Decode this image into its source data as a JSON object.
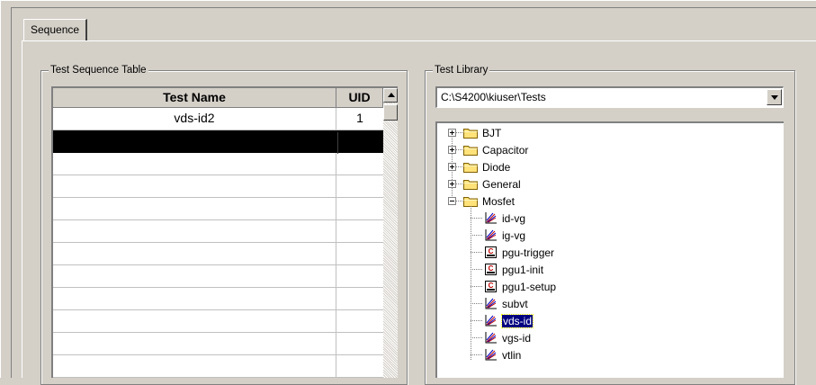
{
  "tab": {
    "label": "Sequence"
  },
  "sequence_group": {
    "title": "Test Sequence Table",
    "columns": [
      "Test Name",
      "UID"
    ],
    "rows": [
      {
        "name": "vds-id2",
        "uid": "1"
      },
      {
        "name": "",
        "uid": ""
      },
      {
        "name": "",
        "uid": ""
      },
      {
        "name": "",
        "uid": ""
      },
      {
        "name": "",
        "uid": ""
      },
      {
        "name": "",
        "uid": ""
      },
      {
        "name": "",
        "uid": ""
      },
      {
        "name": "",
        "uid": ""
      },
      {
        "name": "",
        "uid": ""
      },
      {
        "name": "",
        "uid": ""
      },
      {
        "name": "",
        "uid": ""
      },
      {
        "name": "",
        "uid": ""
      },
      {
        "name": "",
        "uid": ""
      }
    ],
    "selected_row": 1
  },
  "library_group": {
    "title": "Test Library",
    "path_value": "C:\\S4200\\kiuser\\Tests",
    "tree": {
      "folders": [
        {
          "label": "BJT",
          "expanded": false
        },
        {
          "label": "Capacitor",
          "expanded": false
        },
        {
          "label": "Diode",
          "expanded": false
        },
        {
          "label": "General",
          "expanded": false
        },
        {
          "label": "Mosfet",
          "expanded": true
        }
      ],
      "mosfet_children": [
        {
          "label": "id-vg",
          "icon": "graph-icon"
        },
        {
          "label": "ig-vg",
          "icon": "graph-icon"
        },
        {
          "label": "pgu-trigger",
          "icon": "c-module-icon"
        },
        {
          "label": "pgu1-init",
          "icon": "c-module-icon"
        },
        {
          "label": "pgu1-setup",
          "icon": "c-module-icon"
        },
        {
          "label": "subvt",
          "icon": "graph-icon"
        },
        {
          "label": "vds-id",
          "icon": "graph-icon",
          "selected": true
        },
        {
          "label": "vgs-id",
          "icon": "graph-icon"
        },
        {
          "label": "vtlin",
          "icon": "graph-icon"
        }
      ]
    }
  },
  "colors": {
    "face": "#d4d0c8",
    "selection": "#000080",
    "folder": "#ffe27a"
  }
}
